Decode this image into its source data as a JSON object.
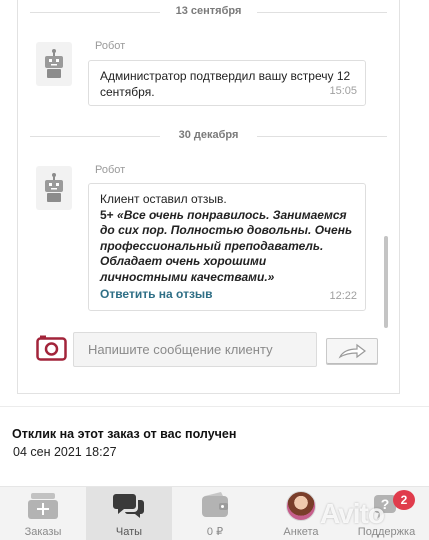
{
  "chat": {
    "separators": [
      {
        "date": "13 сентября"
      },
      {
        "date": "30 декабря"
      }
    ],
    "messages": [
      {
        "sender": "Робот",
        "text": "Администратор подтвердил вашу встречу 12 сентября.",
        "time": "15:05"
      },
      {
        "sender": "Робот",
        "text": "Клиент оставил отзыв.",
        "rating": "5+",
        "review": "«Все очень понравилось. Занимаемся до сих пор. Полностью довольны. Очень профессиональный преподаватель. Обладает очень хорошими личностными качествами.»",
        "reply_link": "Ответить на отзыв",
        "time": "12:22"
      }
    ],
    "composer": {
      "placeholder": "Напишите сообщение клиенту",
      "camera_icon": "camera-icon",
      "send_icon": "send-arrow-icon"
    }
  },
  "order_info": {
    "title": "Отклик на этот заказ от вас получен",
    "date": "04 сен 2021 18:27"
  },
  "bottom_nav": {
    "items": [
      {
        "label": "Заказы",
        "icon": "orders-icon"
      },
      {
        "label": "Чаты",
        "icon": "chat-icon",
        "active": true
      },
      {
        "label": "0 ₽",
        "icon": "wallet-icon"
      },
      {
        "label": "Анкета",
        "icon": "profile-avatar"
      },
      {
        "label": "Поддержка",
        "icon": "support-icon",
        "badge": "2"
      }
    ]
  },
  "watermark": "Avito",
  "colors": {
    "link": "#2f6f86",
    "badge": "#e03c4c",
    "camera": "#a2243a"
  }
}
